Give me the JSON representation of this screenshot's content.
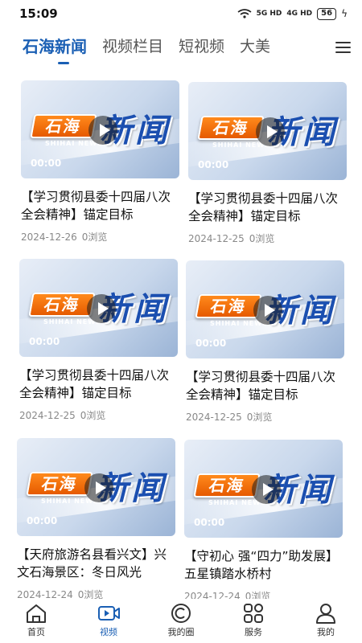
{
  "status": {
    "time": "15:09",
    "signal1": "5G HD",
    "signal2": "4G HD",
    "battery": "56"
  },
  "tabs": [
    {
      "label": "石海新闻",
      "active": true
    },
    {
      "label": "视频栏目",
      "active": false
    },
    {
      "label": "短视频",
      "active": false
    },
    {
      "label": "大美",
      "active": false
    }
  ],
  "videos": [
    {
      "title": "【学习贯彻县委十四届八次全会精神】锚定目标",
      "date": "2024-12-26",
      "views": "0浏览",
      "duration": "00:00",
      "thumb_logo": "石海",
      "thumb_title": "新闻",
      "thumb_sub": "SHIHAI NEWS"
    },
    {
      "title": "【学习贯彻县委十四届八次全会精神】锚定目标",
      "date": "2024-12-25",
      "views": "0浏览",
      "duration": "00:00",
      "thumb_logo": "石海",
      "thumb_title": "新闻",
      "thumb_sub": "SHIHAI NEWS"
    },
    {
      "title": "【学习贯彻县委十四届八次全会精神】锚定目标",
      "date": "2024-12-25",
      "views": "0浏览",
      "duration": "00:00",
      "thumb_logo": "石海",
      "thumb_title": "新闻",
      "thumb_sub": "SHIHAI NEWS"
    },
    {
      "title": "【学习贯彻县委十四届八次全会精神】锚定目标",
      "date": "2024-12-25",
      "views": "0浏览",
      "duration": "00:00",
      "thumb_logo": "石海",
      "thumb_title": "新闻",
      "thumb_sub": "SHIHAI NEWS"
    },
    {
      "title": "【天府旅游名县看兴文】兴文石海景区：冬日风光",
      "date": "2024-12-24",
      "views": "0浏览",
      "duration": "00:00",
      "thumb_logo": "石海",
      "thumb_title": "新闻",
      "thumb_sub": "SHIHAI NEWS"
    },
    {
      "title": "【守初心 强“四力”助发展】五星镇踏水桥村",
      "date": "2024-12-24",
      "views": "0浏览",
      "duration": "00:00",
      "thumb_logo": "石海",
      "thumb_title": "新闻",
      "thumb_sub": "SHIHAI NEWS"
    }
  ],
  "nav": [
    {
      "label": "首页",
      "icon": "home-icon",
      "active": false
    },
    {
      "label": "视频",
      "icon": "video-icon",
      "active": true
    },
    {
      "label": "我的圈",
      "icon": "circle-icon",
      "active": false
    },
    {
      "label": "服务",
      "icon": "grid-icon",
      "active": false
    },
    {
      "label": "我的",
      "icon": "user-icon",
      "active": false
    }
  ],
  "colors": {
    "accent": "#1a5fb4",
    "logo_orange": "#e65a00"
  }
}
